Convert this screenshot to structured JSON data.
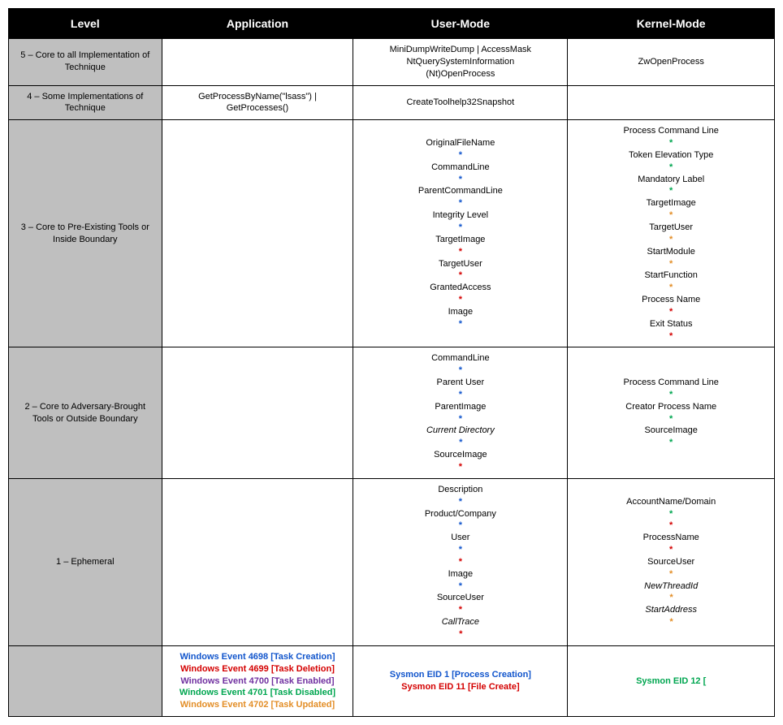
{
  "headers": [
    "Level",
    "Application",
    "User-Mode",
    "Kernel-Mode"
  ],
  "rows": [
    {
      "level": "5 – Core to all Implementation of Technique",
      "app": [],
      "user": [
        {
          "t": "MiniDumpWriteDump | AccessMask"
        },
        {
          "t": "NtQuerySystemInformation"
        },
        {
          "t": "(Nt)OpenProcess"
        }
      ],
      "kernel": [
        {
          "t": "ZwOpenProcess"
        }
      ]
    },
    {
      "level": "4 – Some Implementations of Technique",
      "app": [
        {
          "t": "GetProcessByName(\"lsass\") | GetProcesses()"
        }
      ],
      "user": [
        {
          "t": "CreateToolhelp32Snapshot"
        }
      ],
      "kernel": []
    },
    {
      "level": "3 – Core to Pre-Existing Tools or Inside Boundary",
      "app": [],
      "user": [
        {
          "t": "OriginalFileName",
          "s": "blue"
        },
        {
          "t": "CommandLine",
          "s": "blue"
        },
        {
          "t": "ParentCommandLine",
          "s": "blue"
        },
        {
          "t": "Integrity Level",
          "s": "blue"
        },
        {
          "t": "TargetImage",
          "s": "red"
        },
        {
          "t": "TargetUser",
          "s": "red"
        },
        {
          "t": "GrantedAccess",
          "s": "red"
        },
        {
          "t": "Image",
          "s": "blue"
        }
      ],
      "kernel": [
        {
          "t": "Process Command Line",
          "s": "green"
        },
        {
          "t": "Token Elevation Type",
          "s": "green"
        },
        {
          "t": "Mandatory Label",
          "s": "green"
        },
        {
          "t": "TargetImage",
          "s": "orange"
        },
        {
          "t": "TargetUser",
          "s": "orange"
        },
        {
          "t": "StartModule",
          "s": "orange"
        },
        {
          "t": "StartFunction",
          "s": "orange"
        },
        {
          "t": "Process Name",
          "s": "red"
        },
        {
          "t": "Exit Status",
          "s": "red"
        }
      ]
    },
    {
      "level": "2 – Core to Adversary-Brought Tools or Outside Boundary",
      "app": [],
      "user": [
        {
          "t": "CommandLine",
          "s": "blue"
        },
        {
          "t": "Parent User",
          "s": "blue"
        },
        {
          "t": "ParentImage",
          "s": "blue"
        },
        {
          "t": "Current Directory",
          "s": "blue",
          "ital": true
        },
        {
          "t": "SourceImage",
          "s": "red"
        }
      ],
      "kernel": [
        {
          "t": "Process Command Line",
          "s": "green"
        },
        {
          "t": "Creator Process Name",
          "s": "green"
        },
        {
          "t": "SourceImage",
          "s": "green"
        }
      ]
    },
    {
      "level": "1 – Ephemeral",
      "app": [],
      "user": [
        {
          "t": "Description",
          "s": "blue"
        },
        {
          "t": "Product/Company",
          "s": "blue"
        },
        {
          "t": "User",
          "s": "blue",
          "s2": "red"
        },
        {
          "t": "Image",
          "s": "blue"
        },
        {
          "t": "SourceUser",
          "s": "red"
        },
        {
          "t": "CallTrace",
          "s": "red",
          "ital": true
        }
      ],
      "kernel": [
        {
          "t": "AccountName/Domain",
          "s": "green",
          "s2": "red"
        },
        {
          "t": "ProcessName",
          "s": "red"
        },
        {
          "t": "SourceUser",
          "s": "orange"
        },
        {
          "t": "NewThreadId",
          "s": "orange",
          "ital": true
        },
        {
          "t": "StartAddress",
          "s": "orange",
          "ital": true
        }
      ]
    }
  ],
  "footer": {
    "app": [
      {
        "t": "Windows Event 4698 [Task Creation]",
        "c": "blue"
      },
      {
        "t": "Windows Event 4699 [Task Deletion]",
        "c": "red"
      },
      {
        "t": "Windows Event 4700 [Task Enabled]",
        "c": "purple7"
      },
      {
        "t": "Windows Event 4701 [Task Disabled]",
        "c": "green"
      },
      {
        "t": "Windows Event 4702 [Task Updated]",
        "c": "orange"
      }
    ],
    "user": [
      {
        "t": "Sysmon EID 1 [Process Creation]",
        "c": "blue"
      },
      {
        "t": "Sysmon EID 11 [File Create]",
        "c": "red"
      }
    ],
    "kernel": [
      {
        "t": "Sysmon EID 12 [",
        "c": "green"
      }
    ]
  },
  "chart_data": {
    "type": "table",
    "columns": [
      "Level",
      "Application",
      "User-Mode",
      "Kernel-Mode"
    ],
    "rows": [
      [
        "5 – Core to all Implementation of Technique",
        "",
        "MiniDumpWriteDump | AccessMask; NtQuerySystemInformation; (Nt)OpenProcess",
        "ZwOpenProcess"
      ],
      [
        "4 – Some Implementations of Technique",
        "GetProcessByName(\"lsass\") | GetProcesses()",
        "CreateToolhelp32Snapshot",
        ""
      ],
      [
        "3 – Core to Pre-Existing Tools or Inside Boundary",
        "",
        "OriginalFileName*; CommandLine*; ParentCommandLine*; Integrity Level*; TargetImage*; TargetUser*; GrantedAccess*; Image*",
        "Process Command Line*; Token Elevation Type*; Mandatory Label*; TargetImage*; TargetUser*; StartModule*; StartFunction*; Process Name*; Exit Status*"
      ],
      [
        "2 – Core to Adversary-Brought Tools or Outside Boundary",
        "",
        "CommandLine*; Parent User*; ParentImage*; Current Directory*; SourceImage*",
        "Process Command Line*; Creator Process Name*; SourceImage*"
      ],
      [
        "1 – Ephemeral",
        "",
        "Description*; Product/Company*; User**; Image*; SourceUser*; CallTrace*",
        "AccountName/Domain**; ProcessName*; SourceUser*; NewThreadId*; StartAddress*"
      ],
      [
        "",
        "Windows Event 4698 [Task Creation]; Windows Event 4699 [Task Deletion]; Windows Event 4700 [Task Enabled]; Windows Event 4701 [Task Disabled]; Windows Event 4702 [Task Updated]",
        "Sysmon EID 1 [Process Creation]; Sysmon EID 11 [File Create]",
        "Sysmon EID 12 ["
      ]
    ]
  }
}
